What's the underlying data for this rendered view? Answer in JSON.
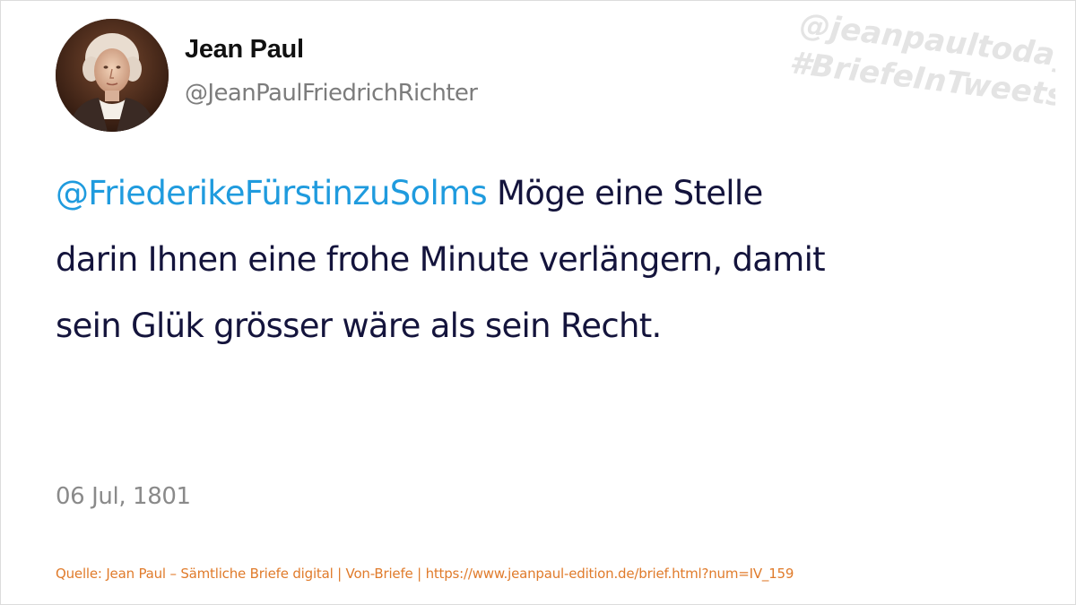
{
  "author": {
    "display_name": "Jean Paul",
    "handle": "@JeanPaulFriedrichRichter",
    "avatar_icon": "portrait-avatar"
  },
  "watermark": {
    "line1": "@jeanpaultoday",
    "line2": "#BriefeInTweets",
    "color": "#e4e4e4"
  },
  "tweet": {
    "mention": "@FriederikeFürstinzuSolms",
    "line1_rest": " Möge eine Stelle",
    "line2": "darin Ihnen eine frohe Minute verlängern, damit",
    "line3": "sein Glük grösser wäre als sein Recht.",
    "mention_color": "#1f9bde",
    "text_color": "#14143c"
  },
  "date": "06 Jul, 1801",
  "source": {
    "text": "Quelle: Jean Paul – Sämtliche Briefe digital | Von-Briefe | https://www.jeanpaul-edition.de/brief.html?num=IV_159",
    "color": "#e07b2b"
  }
}
